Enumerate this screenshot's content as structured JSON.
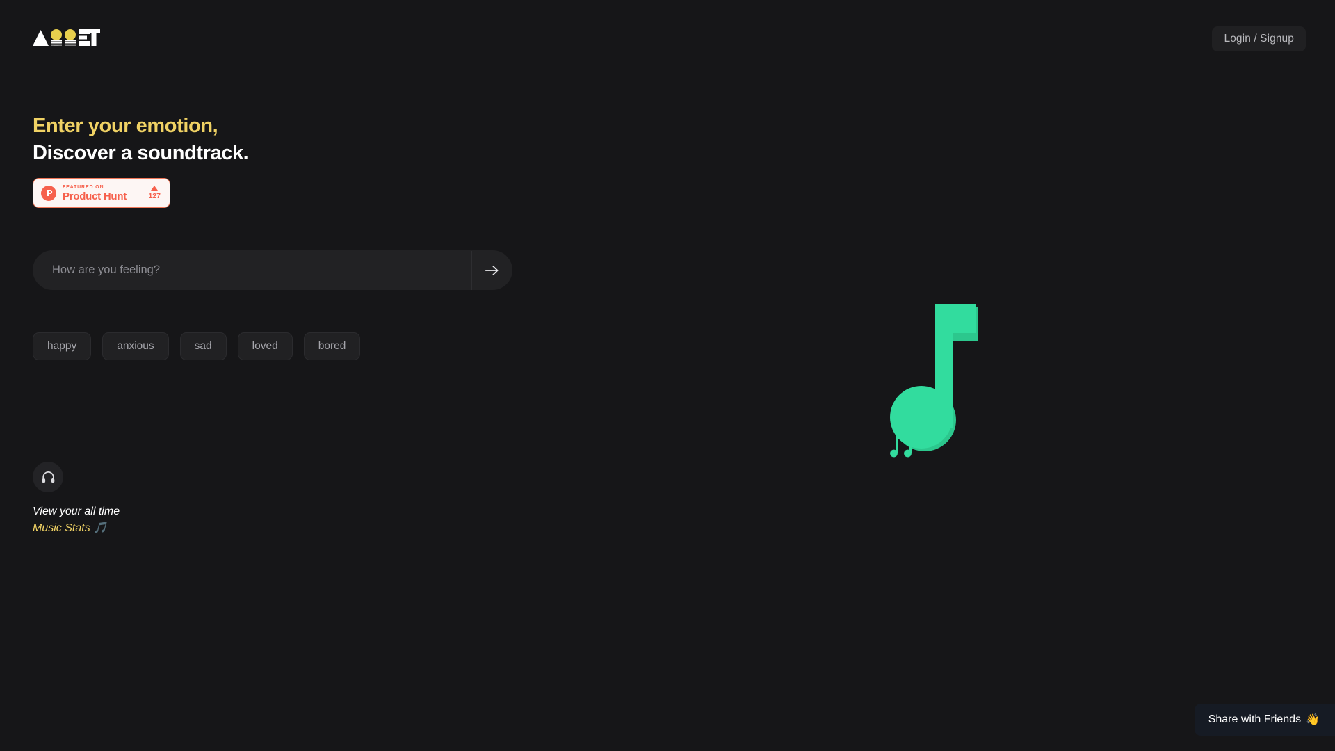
{
  "page": {
    "background_color": "#161618"
  },
  "header": {
    "logo_text": "ASSET",
    "logo_icon": "asset-wordmark",
    "login_label": "Login / Signup"
  },
  "hero": {
    "headline_line_1": "Enter your emotion,",
    "headline_line_2": "Discover a soundtrack.",
    "headline_1_color": "#f0d264",
    "headline_2_color": "#ffffff"
  },
  "product_hunt": {
    "featured_label": "FEATURED ON",
    "product_name": "Product Hunt",
    "upvote_count": "127",
    "accent_color": "#f6604c",
    "logo_letter": "P"
  },
  "search": {
    "placeholder": "How are you feeling?",
    "value": "",
    "submit_icon": "arrow-right-icon"
  },
  "chips": [
    {
      "label": "happy"
    },
    {
      "label": "anxious"
    },
    {
      "label": "sad"
    },
    {
      "label": "loved"
    },
    {
      "label": "bored"
    }
  ],
  "stats": {
    "icon": "headphones-icon",
    "line_1": "View your all time",
    "line_2": "Music Stats 🎵",
    "line_2_color": "#f0d264"
  },
  "illustration": {
    "name": "music-note-illustration",
    "color": "#32dc9e",
    "shade_color": "#2cc78d"
  },
  "share": {
    "label": "Share with Friends",
    "emoji": "👋",
    "background_color": "#161b24"
  }
}
